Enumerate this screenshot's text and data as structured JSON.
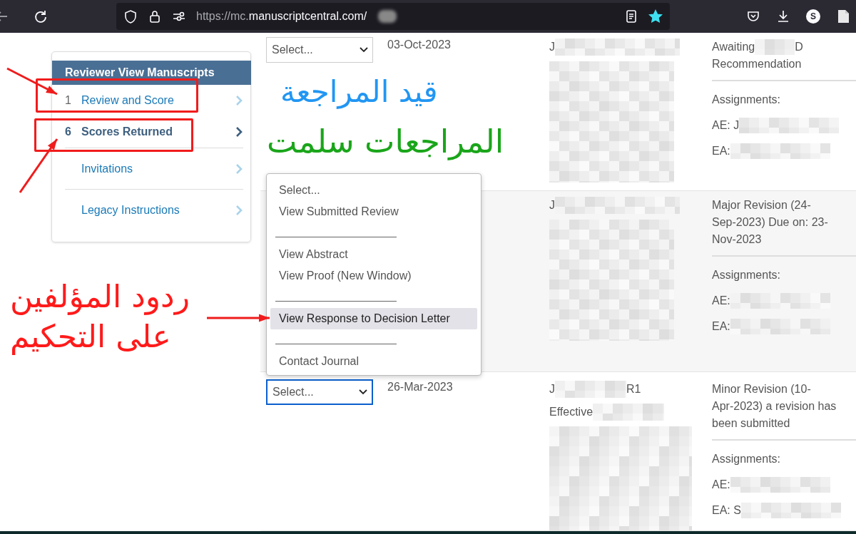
{
  "browser": {
    "url_scheme": "https://mc.",
    "url_domain": "manuscriptcentral.com/",
    "bookmarked": true,
    "profile_initial": "S"
  },
  "sidebar": {
    "title": "Reviewer View Manuscripts",
    "items": [
      {
        "count": "1",
        "label": "Review and Score",
        "selected": false
      },
      {
        "count": "6",
        "label": "Scores Returned",
        "selected": true
      },
      {
        "label": "Invitations",
        "selected": false
      },
      {
        "label": "Legacy Instructions",
        "selected": false
      }
    ]
  },
  "rows": [
    {
      "select": "Select...",
      "focused": false,
      "date": "03-Oct-2023",
      "title_lines": [
        [
          {
            "kind": "text",
            "text": "J"
          },
          {
            "kind": "blurred"
          }
        ]
      ],
      "status_lines": [
        [
          {
            "kind": "text",
            "text": "Awaiting"
          },
          {
            "kind": "blurred"
          },
          {
            "kind": "text",
            "text": "D"
          }
        ],
        [
          {
            "kind": "text",
            "text": "Recommendation"
          }
        ]
      ],
      "assignments_label": "Assignments:",
      "ae": "AE: J",
      "ea": "EA:"
    },
    {
      "title_lines": [
        [
          {
            "kind": "text",
            "text": "J"
          },
          {
            "kind": "blurred"
          }
        ]
      ],
      "status_lines": [
        [
          {
            "kind": "text",
            "text": "Major Revision (24-"
          }
        ],
        [
          {
            "kind": "text",
            "text": "Sep-2023) Due on: 23-"
          }
        ],
        [
          {
            "kind": "text",
            "text": "Nov-2023"
          }
        ]
      ],
      "assignments_label": "Assignments:",
      "ae": "AE:",
      "ea": "EA:"
    },
    {
      "select": "Select...",
      "focused": true,
      "date": "26-Mar-2023",
      "title_lines": [
        [
          {
            "kind": "text",
            "text": "J"
          },
          {
            "kind": "blurred"
          },
          {
            "kind": "text",
            "text": "R1"
          }
        ],
        [
          {
            "kind": "text",
            "text": "Effective"
          },
          {
            "kind": "blurred"
          }
        ]
      ],
      "status_lines": [
        [
          {
            "kind": "text",
            "text": "Minor Revision (10-"
          }
        ],
        [
          {
            "kind": "text",
            "text": "Apr-2023) a revision has"
          }
        ],
        [
          {
            "kind": "text",
            "text": "been submitted"
          }
        ]
      ],
      "assignments_label": "Assignments:",
      "ae": "AE:",
      "ea": "EA: S"
    }
  ],
  "dropdown": {
    "options": [
      {
        "kind": "option",
        "label": "Select...",
        "selected": false
      },
      {
        "kind": "option",
        "label": "View Submitted Review",
        "selected": false
      },
      {
        "kind": "separator"
      },
      {
        "kind": "option",
        "label": "View Abstract",
        "selected": false
      },
      {
        "kind": "option",
        "label": "View Proof (New Window)",
        "selected": false
      },
      {
        "kind": "separator"
      },
      {
        "kind": "option",
        "label": "View Response to Decision Letter",
        "selected": true
      },
      {
        "kind": "separator"
      },
      {
        "kind": "option",
        "label": "Contact Journal",
        "selected": false
      }
    ]
  },
  "annotations": [
    {
      "text": "قيد المراجعة",
      "color": "#2196f3"
    },
    {
      "text": "المراجعات سلمت",
      "color": "#1aa51a"
    },
    {
      "text": "ردود المؤلفين على التحكيم",
      "color": "#ff1a1a"
    }
  ]
}
